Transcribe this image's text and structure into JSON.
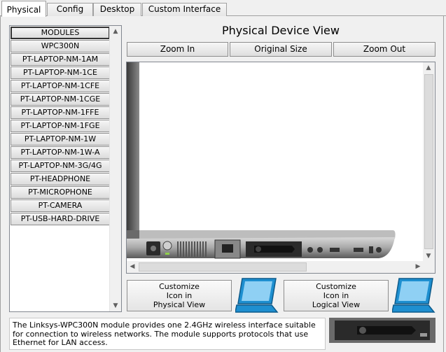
{
  "tabs": [
    {
      "label": "Physical",
      "active": true
    },
    {
      "label": "Config",
      "active": false
    },
    {
      "label": "Desktop",
      "active": false
    },
    {
      "label": "Custom Interface",
      "active": false
    }
  ],
  "modules": {
    "items": [
      "MODULES",
      "WPC300N",
      "PT-LAPTOP-NM-1AM",
      "PT-LAPTOP-NM-1CE",
      "PT-LAPTOP-NM-1CFE",
      "PT-LAPTOP-NM-1CGE",
      "PT-LAPTOP-NM-1FFE",
      "PT-LAPTOP-NM-1FGE",
      "PT-LAPTOP-NM-1W",
      "PT-LAPTOP-NM-1W-A",
      "PT-LAPTOP-NM-3G/4G",
      "PT-HEADPHONE",
      "PT-MICROPHONE",
      "PT-CAMERA",
      "PT-USB-HARD-DRIVE"
    ],
    "selected_index": 0
  },
  "view": {
    "title": "Physical Device View",
    "zoom_in": "Zoom In",
    "original_size": "Original Size",
    "zoom_out": "Zoom Out"
  },
  "customize": {
    "physical": [
      "Customize",
      "Icon in",
      "Physical View"
    ],
    "logical": [
      "Customize",
      "Icon in",
      "Logical View"
    ]
  },
  "description": "The Linksys-WPC300N module provides one 2.4GHz wireless interface suitable for connection to wireless networks. The module supports protocols that use Ethernet for LAN access.",
  "colors": {
    "laptop_icon": "#1e8fd0",
    "tab_border": "#a0a0a0"
  }
}
